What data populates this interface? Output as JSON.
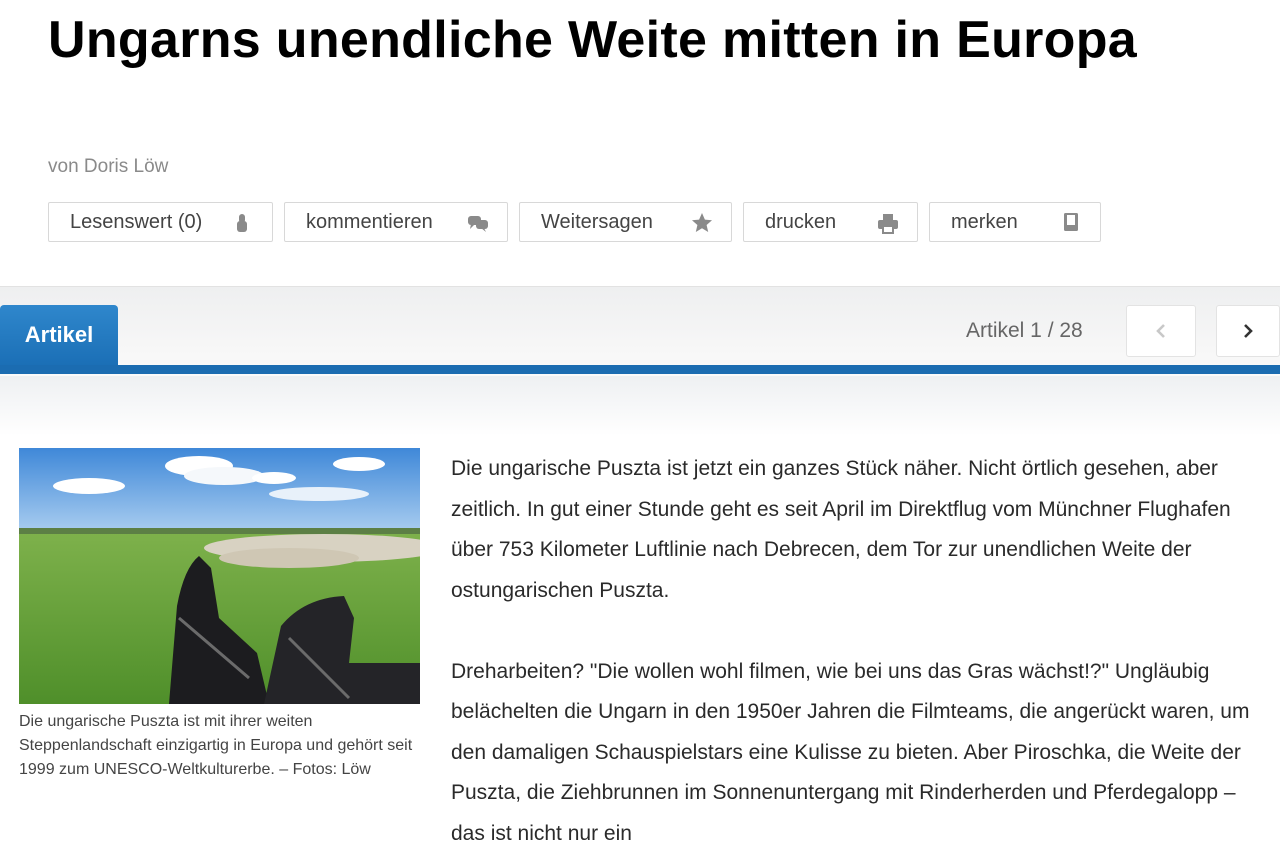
{
  "article": {
    "title": "Ungarns unendliche Weite mitten in Europa",
    "author": "von Doris Löw"
  },
  "actions": [
    {
      "label": "Lesenswert (0)",
      "icon": "thumb-up-icon"
    },
    {
      "label": "kommentieren",
      "icon": "comment-icon"
    },
    {
      "label": "Weitersagen",
      "icon": "star-icon"
    },
    {
      "label": "drucken",
      "icon": "printer-icon"
    },
    {
      "label": "merken",
      "icon": "bookmark-icon"
    }
  ],
  "tabs": {
    "active": "Artikel",
    "counter": "Artikel 1 / 28",
    "prev_icon": "chevron-left-icon",
    "next_icon": "chevron-right-icon"
  },
  "figure": {
    "caption": "Die ungarische Puszta ist mit ihrer weiten Steppenlandschaft einzigartig in Europa und gehört seit 1999 zum UNESCO-Weltkulturerbe. – Fotos: Löw"
  },
  "body": {
    "paragraphs": [
      "Die ungarische Puszta ist jetzt ein ganzes Stück näher. Nicht örtlich gesehen, aber zeitlich. In gut einer Stunde geht es seit April im Direktflug vom Münchner Flughafen über 753 Kilometer Luftlinie nach Debrecen, dem Tor zur unendlichen Weite der ostungarischen Puszta.",
      "Dreharbeiten? \"Die wollen wohl filmen, wie bei uns das Gras wächst!?\" Ungläubig belächelten die Ungarn in den 1950er Jahren die Filmteams, die angerückt waren, um den damaligen Schauspielstars eine Kulisse zu bieten. Aber Piroschka, die Weite der Puszta, die Ziehbrunnen im Sonnenuntergang mit Rinderherden und Pferdegalopp – das ist nicht nur ein"
    ]
  },
  "colors": {
    "accent": "#1b6cb1",
    "tab_active": "#2f87cc",
    "icon_gray": "#8a8a8a"
  }
}
